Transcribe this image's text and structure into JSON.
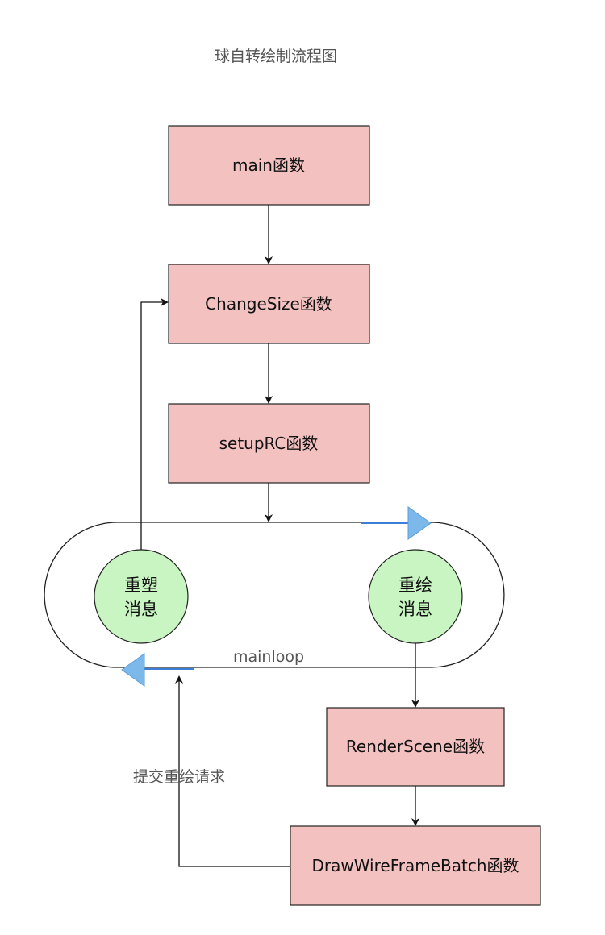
{
  "title": "球自转绘制流程图",
  "boxes": {
    "main": "main函数",
    "change_size": "ChangeSize函数",
    "setup_rc": "setupRC函数",
    "render_scene": "RenderScene函数",
    "draw_wire_frame_batch": "DrawWireFrameBatch函数"
  },
  "circles": {
    "reshape": [
      "重塑",
      "消息"
    ],
    "redraw": [
      "重绘",
      "消息"
    ]
  },
  "loop_label": "mainloop",
  "side_label": "提交重绘请求",
  "colors": {
    "box_fill": "#f4c1c1",
    "circle_fill": "#c8f5c1",
    "arrow_blue": "#7db8ea"
  }
}
